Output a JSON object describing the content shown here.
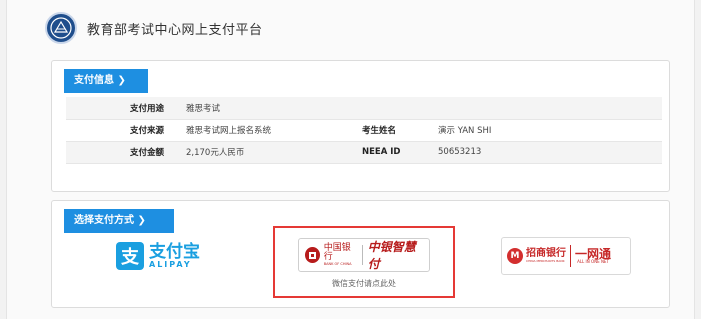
{
  "header": {
    "title": "教育部考试中心网上支付平台"
  },
  "payment_info": {
    "tab_label": "支付信息 ❯",
    "rows": [
      {
        "label": "支付用途",
        "value": "雅思考试",
        "label2": "",
        "value2": ""
      },
      {
        "label": "支付来源",
        "value": "雅思考试网上报名系统",
        "label2": "考生姓名",
        "value2": "演示  YAN SHI"
      },
      {
        "label": "支付金额",
        "value": "2,170元人民币",
        "label2": "NEEA ID",
        "value2": "50653213"
      }
    ]
  },
  "payment_method": {
    "tab_label": "选择支付方式 ❯",
    "alipay": {
      "icon_char": "支",
      "name_cn": "支付宝",
      "name_en": "ALIPAY"
    },
    "boc": {
      "name_cn": "中国银行",
      "name_en": "BANK OF CHINA",
      "brand": "中银智慧付",
      "note": "微信支付请点此处"
    },
    "cmb": {
      "icon_char": "M",
      "name_cn": "招商银行",
      "name_en": "CHINA MERCHANTS BANK",
      "brand_cn": "一网通",
      "brand_en": "ALL IN ONE NET"
    },
    "highlight_color": "#e53935"
  },
  "colors": {
    "accent": "#1e8fe1",
    "alipay": "#1a9fe0",
    "bank_red": "#b71c1c"
  }
}
